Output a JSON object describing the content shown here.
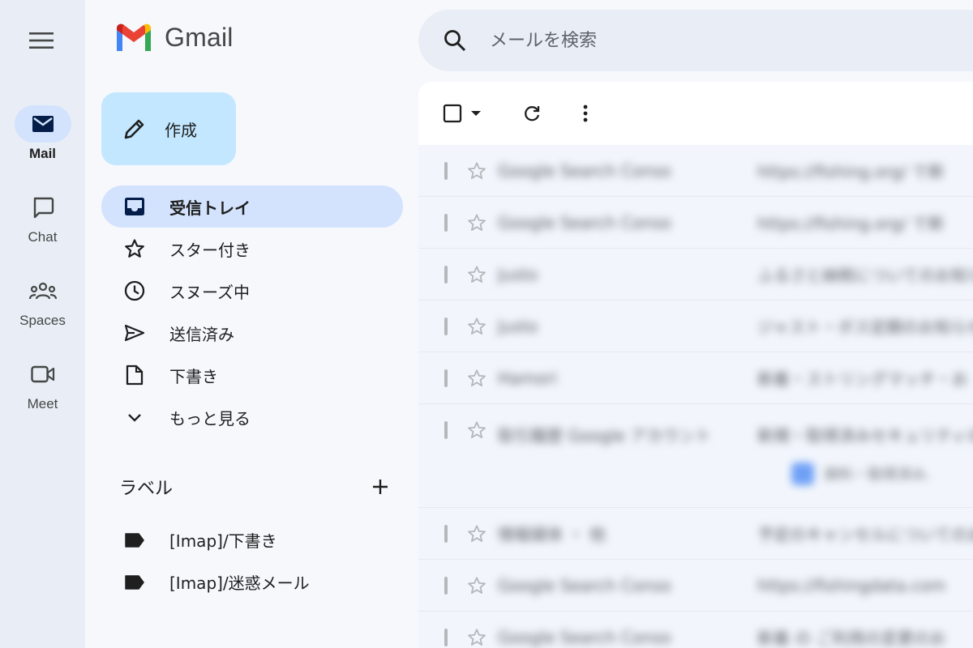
{
  "rail": {
    "items": [
      {
        "label": "Mail",
        "icon": "mail-icon",
        "active": true
      },
      {
        "label": "Chat",
        "icon": "chat-icon",
        "active": false
      },
      {
        "label": "Spaces",
        "icon": "spaces-icon",
        "active": false
      },
      {
        "label": "Meet",
        "icon": "meet-icon",
        "active": false
      }
    ]
  },
  "app": {
    "name": "Gmail"
  },
  "compose": {
    "label": "作成"
  },
  "nav": {
    "items": [
      {
        "label": "受信トレイ",
        "icon": "inbox-icon",
        "active": true
      },
      {
        "label": "スター付き",
        "icon": "star-icon"
      },
      {
        "label": "スヌーズ中",
        "icon": "clock-icon"
      },
      {
        "label": "送信済み",
        "icon": "send-icon"
      },
      {
        "label": "下書き",
        "icon": "draft-icon"
      },
      {
        "label": "もっと見る",
        "icon": "chevron-down-icon"
      }
    ]
  },
  "labels": {
    "title": "ラベル",
    "items": [
      {
        "label": "[Imap]/下書き"
      },
      {
        "label": "[Imap]/迷惑メール"
      }
    ]
  },
  "search": {
    "placeholder": "メールを検索"
  },
  "emails": [
    {
      "sender": "Google Search Conso",
      "subject": "https://fishing.org/ で新"
    },
    {
      "sender": "Google Search Conso",
      "subject": "https://fishing.org/ で新"
    },
    {
      "sender": "Justo",
      "subject": "ふるさと納税についてのお知らせ"
    },
    {
      "sender": "Justo",
      "subject": "ジャスト・ボス定期のお知らせ"
    },
    {
      "sender": "Hamori",
      "subject": "新着・ストリングマッチ・お"
    },
    {
      "sender": "取引履歴 Google アカウント",
      "subject": "新規・取得済みセキュリティの",
      "attachment": "資料・取得済み."
    },
    {
      "sender": "情報媒体 ・ 他",
      "subject": "予定のキャンセルについてのお"
    },
    {
      "sender": "Google Search Conso",
      "subject": "https://fishingdata.com"
    },
    {
      "sender": "Google Search Conso",
      "subject": "新着 の ご利用の変更のお"
    }
  ],
  "colors": {
    "accent": "#0b57d0",
    "compose": "#c2e7ff",
    "activeNav": "#d3e3fd",
    "background": "#f6f8fc"
  }
}
